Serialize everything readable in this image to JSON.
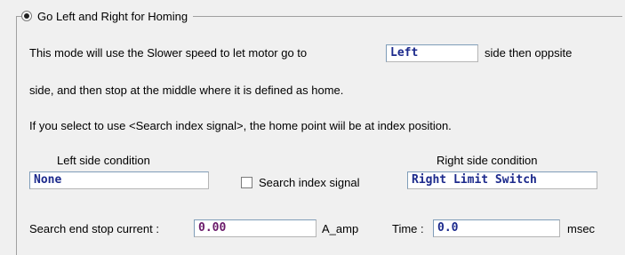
{
  "group": {
    "radio_label": "Go Left and Right for Homing",
    "radio_selected": true
  },
  "description": {
    "line1_prefix": "This mode will use the Slower speed to let motor go to",
    "direction_value": "Left",
    "line1_suffix": "side then oppsite",
    "line2": "side, and then stop at the middle where it is defined as home.",
    "line3": "If you select to use <Search index signal>, the home point wiil be at index position."
  },
  "left_side": {
    "label": "Left side condition",
    "value": "None"
  },
  "search_index": {
    "label": "Search index signal",
    "checked": false
  },
  "right_side": {
    "label": "Right side condition",
    "value": "Right Limit Switch"
  },
  "search_end": {
    "label": "Search end stop current :",
    "value": "0.00",
    "unit": "A_amp"
  },
  "time": {
    "label": "Time :",
    "value": "0.0",
    "unit": "msec"
  }
}
